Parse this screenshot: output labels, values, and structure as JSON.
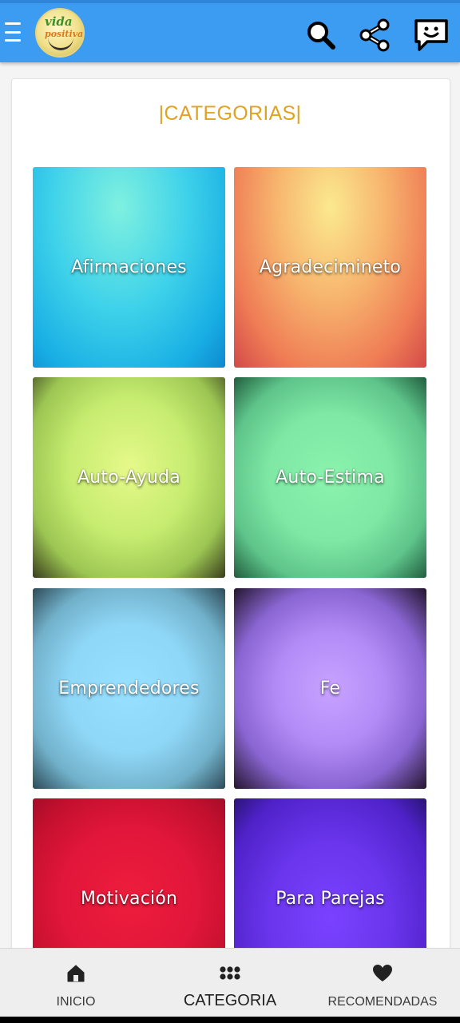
{
  "header": {
    "logo_text_1": "vida",
    "logo_text_2": "positiva",
    "icons": [
      "menu-icon",
      "search-icon",
      "share-icon",
      "chat-icon"
    ],
    "bar_color": "#3b9cf2"
  },
  "main": {
    "title": "|CATEGORIAS|",
    "title_color": "#e0a320",
    "categories": [
      {
        "label": "Afirmaciones"
      },
      {
        "label": "Agradecimineto"
      },
      {
        "label": "Auto-Ayuda"
      },
      {
        "label": "Auto-Estima"
      },
      {
        "label": "Emprendedores"
      },
      {
        "label": "Fe"
      },
      {
        "label": "Motivación"
      },
      {
        "label": "Para Parejas"
      }
    ]
  },
  "bottom_nav": {
    "items": [
      {
        "label": "INICIO",
        "icon": "home-icon"
      },
      {
        "label": "CATEGORIA",
        "icon": "grid-icon",
        "active": true
      },
      {
        "label": "RECOMENDADAS",
        "icon": "heart-icon"
      }
    ]
  }
}
